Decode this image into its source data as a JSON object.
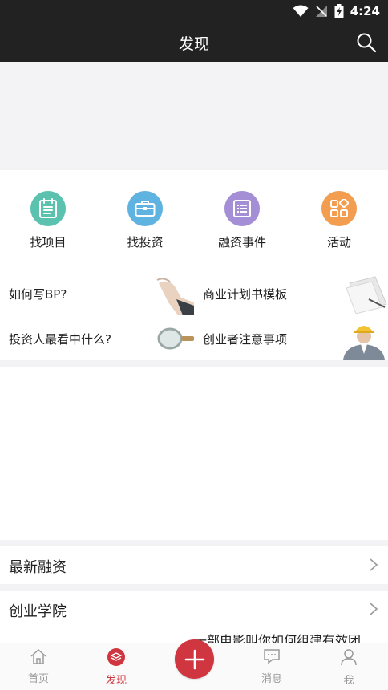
{
  "status_bar": {
    "time": "4:24"
  },
  "header": {
    "title": "发现"
  },
  "categories": [
    {
      "label": "找项目",
      "icon": "clipboard-icon",
      "color": "#5bc2b0"
    },
    {
      "label": "找投资",
      "icon": "briefcase-icon",
      "color": "#5fb3e0"
    },
    {
      "label": "融资事件",
      "icon": "list-icon",
      "color": "#a48ed6"
    },
    {
      "label": "活动",
      "icon": "grid-icon",
      "color": "#f29d4f"
    }
  ],
  "guides": [
    {
      "label": "如何写BP?",
      "image": "handshake-image"
    },
    {
      "label": "商业计划书模板",
      "image": "documents-image"
    },
    {
      "label": "投资人最看中什么?",
      "image": "magnifier-image"
    },
    {
      "label": "创业者注意事项",
      "image": "engineer-image"
    }
  ],
  "sections": {
    "latest_funding": "最新融资",
    "startup_academy": "创业学院"
  },
  "article_peek": "一部电影叫你如何组建有效团",
  "tabs": [
    {
      "label": "首页",
      "icon": "home-icon"
    },
    {
      "label": "发现",
      "icon": "discover-icon"
    },
    {
      "label": "消息",
      "icon": "message-icon"
    },
    {
      "label": "我",
      "icon": "profile-icon"
    }
  ],
  "active_tab": "发现",
  "colors": {
    "accent": "#d0363f",
    "header_bg": "#222222",
    "divider": "#f3f3f5"
  }
}
